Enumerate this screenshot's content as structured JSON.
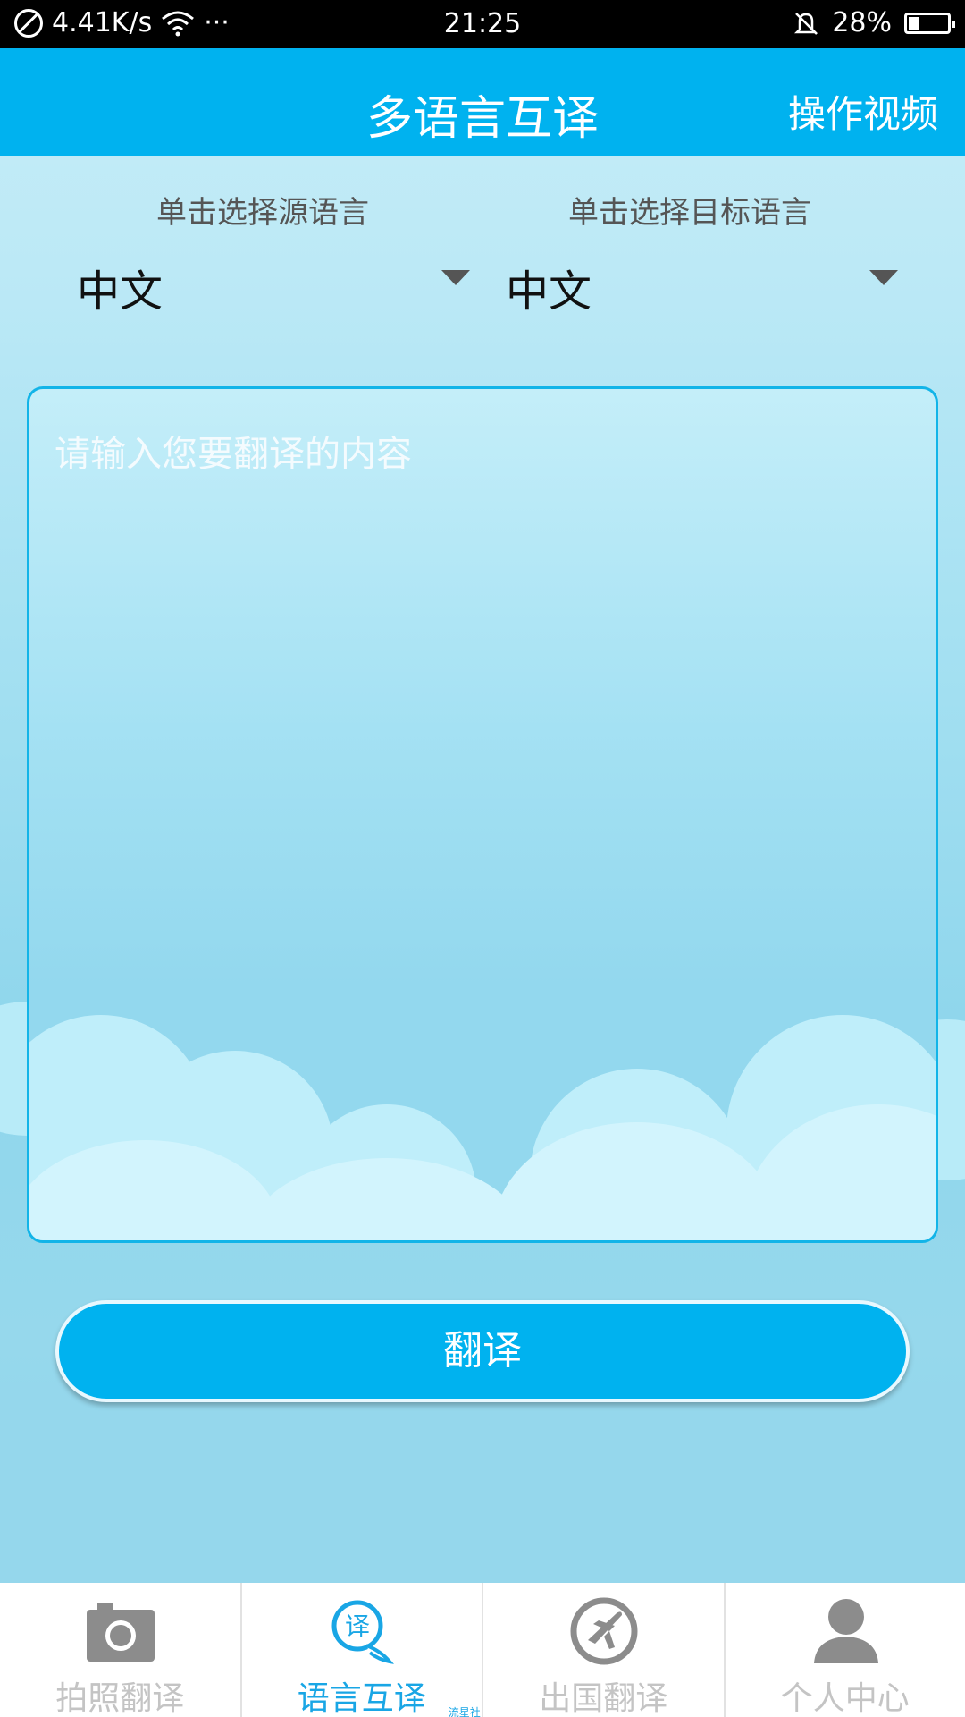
{
  "status_bar": {
    "network_speed": "4.41K/s",
    "more": "···",
    "time": "21:25",
    "battery": "28%",
    "battery_level": 0.28
  },
  "header": {
    "title": "多语言互译",
    "action": "操作视频"
  },
  "source_language": {
    "hint": "单击选择源语言",
    "value": "中文"
  },
  "target_language": {
    "hint": "单击选择目标语言",
    "value": "中文"
  },
  "input": {
    "placeholder": "请输入您要翻译的内容",
    "value": ""
  },
  "translate_button": {
    "label": "翻译"
  },
  "bottom_nav": {
    "items": [
      {
        "label": "拍照翻译",
        "icon": "camera-icon",
        "active": false
      },
      {
        "label": "语言互译",
        "icon": "translate-chat-icon",
        "active": true
      },
      {
        "label": "出国翻译",
        "icon": "airplane-icon",
        "active": false
      },
      {
        "label": "个人中心",
        "icon": "person-icon",
        "active": false
      }
    ]
  },
  "watermark": "流星社区",
  "colors": {
    "accent": "#00b2ef",
    "active_nav": "#19a6e5",
    "inactive_nav": "#c4c4c4"
  }
}
